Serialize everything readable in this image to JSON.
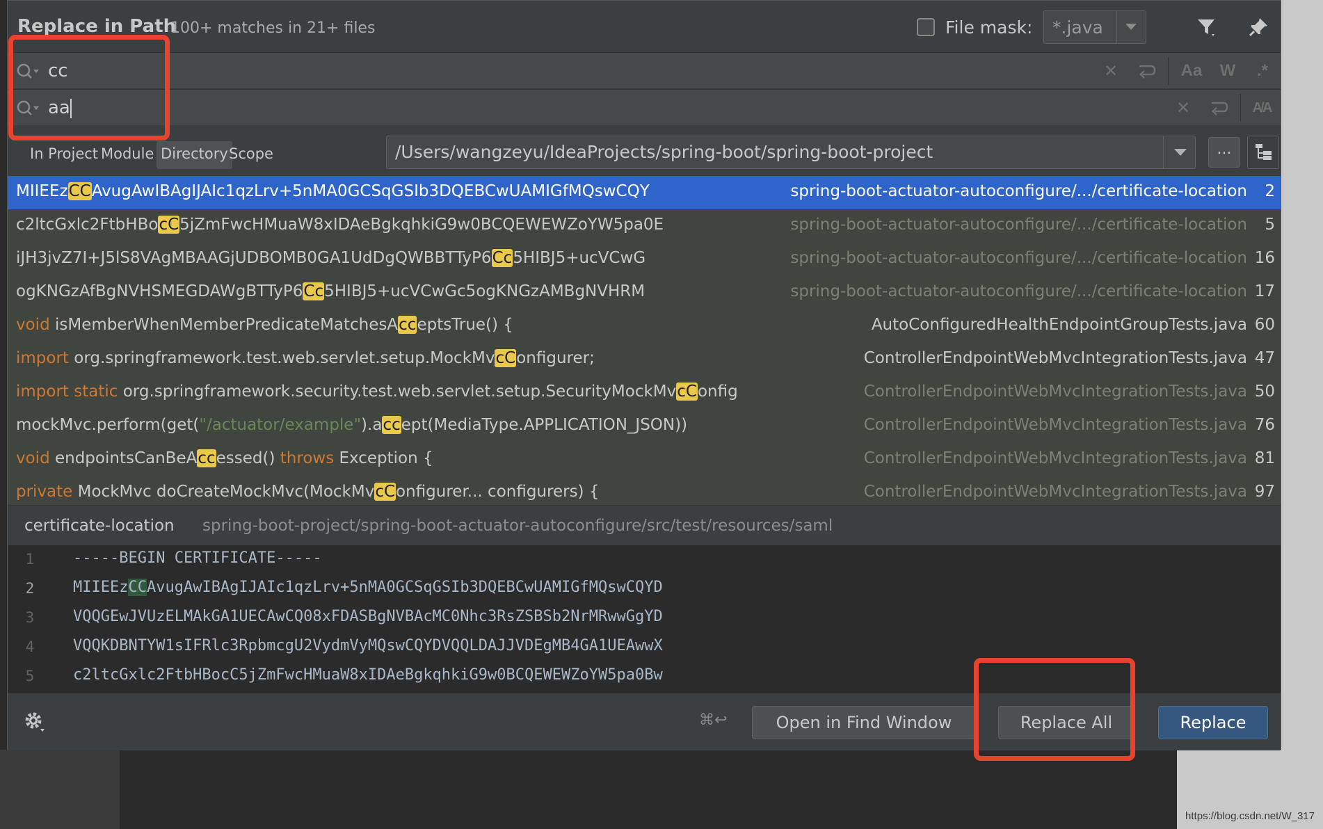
{
  "dialog": {
    "title": "Replace in Path",
    "match_count": "100+ matches in 21+ files",
    "file_mask_label": "File mask:",
    "file_mask_value": "*.java"
  },
  "find": {
    "value": "cc"
  },
  "replace": {
    "value": "aa"
  },
  "scope": {
    "tabs": [
      {
        "label": "In Project"
      },
      {
        "label": "Module"
      },
      {
        "label": "Directory"
      },
      {
        "label": "Scope"
      }
    ],
    "active_tab": "Directory",
    "path": "/Users/wangzeyu/IdeaProjects/spring-boot/spring-boot-project",
    "browse_label": "..."
  },
  "results": [
    {
      "pre": "",
      "before": "MIIEEz",
      "match": "CC",
      "after": "AvugAwIBAgIJAIc1qzLrv+5nMA0GCSqGSIb3DQEBCwUAMIGfMQswCQY",
      "file": "spring-boot-actuator-autoconfigure/.../certificate-location",
      "line": "2"
    },
    {
      "pre": "",
      "before": "c2ltcGxlc2FtbHBo",
      "match": "cC",
      "after": "5jZmFwcHMuaW8xIDAeBgkqhkiG9w0BCQEWEWZoYW5pa0E",
      "file": "spring-boot-actuator-autoconfigure/.../certificate-location",
      "line": "5"
    },
    {
      "pre": "",
      "before": "iJH3jvZ7I+J5lS8VAgMBAAGjUDBOMB0GA1UdDgQWBBTTyP6",
      "match": "Cc",
      "after": "5HIBJ5+ucVCwG",
      "file": "spring-boot-actuator-autoconfigure/.../certificate-location",
      "line": "16"
    },
    {
      "pre": "",
      "before": "ogKNGzAfBgNVHSMEGDAWgBTTyP6",
      "match": "Cc",
      "after": "5HIBJ5+ucVCwGc5ogKNGzAMBgNVHRM",
      "file": "spring-boot-actuator-autoconfigure/.../certificate-location",
      "line": "17"
    },
    {
      "pre": "void ",
      "before": "isMemberWhenMemberPredicateMatchesA",
      "match": "cc",
      "after": "eptsTrue() {",
      "file": "AutoConfiguredHealthEndpointGroupTests.java",
      "line": "60"
    },
    {
      "pre": "import ",
      "before": "org.springframework.test.web.servlet.setup.MockMv",
      "match": "cC",
      "after": "onfigurer;",
      "file": "ControllerEndpointWebMvcIntegrationTests.java",
      "line": "47"
    },
    {
      "pre": "import static ",
      "before": "org.springframework.security.test.web.servlet.setup.SecurityMockMv",
      "match": "cC",
      "after": "onfig",
      "file": "ControllerEndpointWebMvcIntegrationTests.java",
      "line": "50"
    },
    {
      "pre": "",
      "before": "mockMvc.perform(get(",
      "str": "\"/actuator/example\"",
      "before2": ").a",
      "match": "cc",
      "after": "ept(MediaType.APPLICATION_JSON))",
      "file": "ControllerEndpointWebMvcIntegrationTests.java",
      "line": "76"
    },
    {
      "pre": "void ",
      "before": "endpointsCanBeA",
      "match": "cc",
      "after": "essed() ",
      "kw2": "throws",
      "after2": " Exception {",
      "file": "ControllerEndpointWebMvcIntegrationTests.java",
      "line": "81"
    },
    {
      "pre": "private ",
      "before": "MockMvc doCreateMockMvc(MockMv",
      "match": "cC",
      "after": "onfigurer... configurers) {",
      "file": "ControllerEndpointWebMvcIntegrationTests.java",
      "line": "97"
    }
  ],
  "preview": {
    "file_name": "certificate-location",
    "file_path": "spring-boot-project/spring-boot-actuator-autoconfigure/src/test/resources/saml",
    "lines": [
      {
        "num": "1",
        "text": "-----BEGIN CERTIFICATE-----"
      },
      {
        "num": "2",
        "before": "MIIEEz",
        "match": "CC",
        "after": "AvugAwIBAgIJAIc1qzLrv+5nMA0GCSqGSIb3DQEBCwUAMIGfMQswCQYD"
      },
      {
        "num": "3",
        "text": "VQQGEwJVUzELMAkGA1UECAwCQ08xFDASBgNVBAcMC0Nhc3RsZSBSb2NrMRwwGgYD"
      },
      {
        "num": "4",
        "text": "VQQKDBNTYW1sIFRlc3RpbmcgU2VydmVyMQswCQYDVQQLDAJJVDEgMB4GA1UEAwwX"
      },
      {
        "num": "5",
        "text": "c2ltcGxlc2FtbHBocC5jZmFwcHMuaW8xIDAeBgkqhkiG9w0BCQEWEWZoYW5pa0Bw"
      }
    ]
  },
  "footer": {
    "shortcut": "⌘↩",
    "open_in_find_window": "Open in Find Window",
    "replace_all": "Replace All",
    "replace": "Replace"
  },
  "watermark": "https://blog.csdn.net/W_317",
  "colors": {
    "selection": "#2f65ca",
    "match_highlight": "#e9c84a",
    "annotation": "#e8432e",
    "keyword": "#cc7832",
    "string": "#6a8759"
  }
}
